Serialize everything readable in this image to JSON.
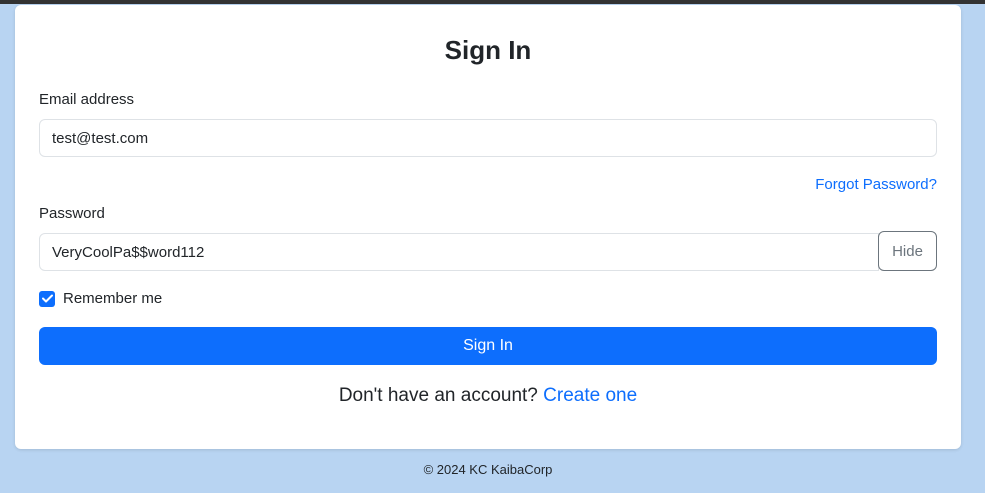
{
  "form": {
    "title": "Sign In",
    "email_label": "Email address",
    "email_value": "test@test.com",
    "forgot_password": "Forgot Password?",
    "password_label": "Password",
    "password_value": "VeryCoolPa$$word112",
    "hide_button": "Hide",
    "remember_label": "Remember me",
    "remember_checked": true,
    "submit_label": "Sign In",
    "signup_prompt": "Don't have an account?",
    "signup_link": "Create one"
  },
  "footer": {
    "text": "© 2024 KC KaibaCorp"
  },
  "colors": {
    "background": "#b8d4f2",
    "primary": "#0d6efd",
    "card": "#ffffff"
  }
}
